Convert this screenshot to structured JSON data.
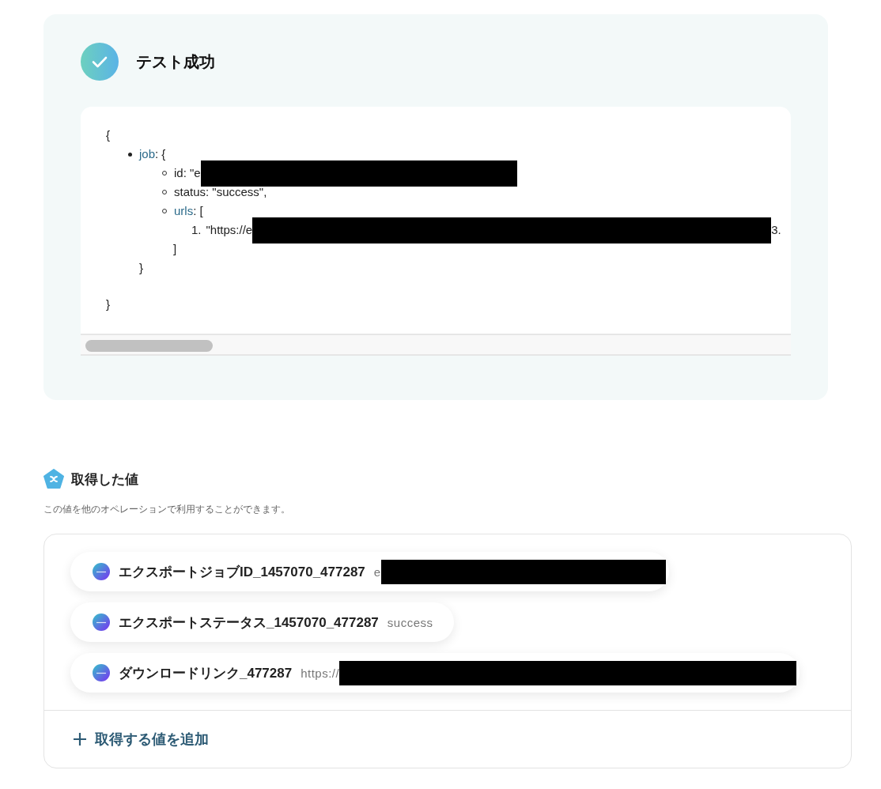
{
  "result_card": {
    "title": "テスト成功",
    "json_view": {
      "open": "{",
      "close": "}",
      "items": [
        {
          "kind": "object",
          "key": "job",
          "after": ": {",
          "close": "}",
          "children": [
            {
              "kind": "text",
              "text": "id: \"e",
              "redacted": true
            },
            {
              "kind": "text",
              "text": "status: \"success\",",
              "redacted": false
            },
            {
              "kind": "array",
              "key": "urls",
              "after": ": [",
              "close": "]",
              "entries": [
                {
                  "number": "1.",
                  "text": "\"https://e",
                  "redacted": true,
                  "tail": "3."
                }
              ]
            }
          ]
        }
      ]
    }
  },
  "values_section": {
    "title": "取得した値",
    "description": "この値を他のオペレーションで利用することができます。",
    "values": [
      {
        "name": "エクスポートジョブID_1457070_477287",
        "value": "e",
        "redacted": true
      },
      {
        "name": "エクスポートステータス_1457070_477287",
        "value": "success",
        "redacted": false
      },
      {
        "name": "ダウンロードリンク_477287",
        "value": "https://",
        "redacted": true
      }
    ],
    "add_button": "取得する値を追加"
  }
}
